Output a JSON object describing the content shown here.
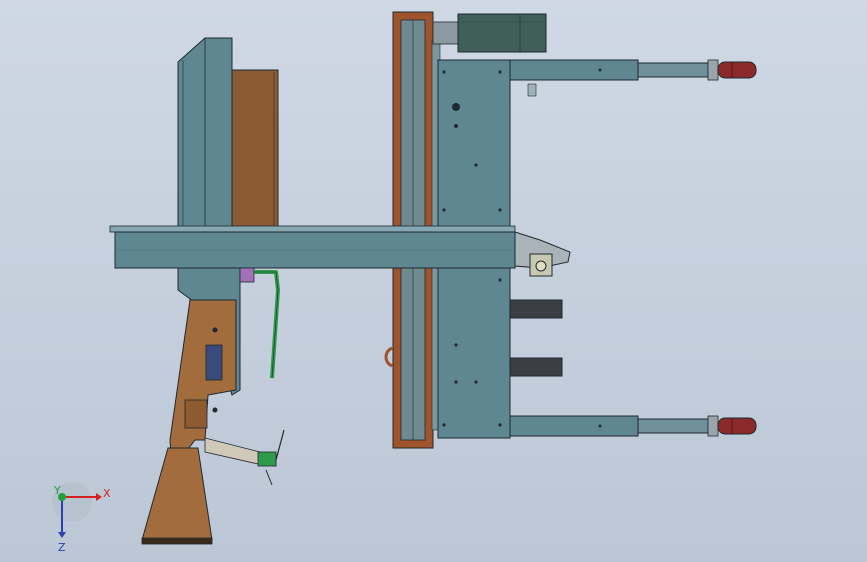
{
  "triad": {
    "x_label": "X",
    "y_label": "Y",
    "z_label": "Z",
    "x_color": "#d42020",
    "y_color": "#20a040",
    "z_color": "#2a3fb0"
  },
  "colors": {
    "background_top": "#cfd8e4",
    "background_bottom": "#bcc7d6",
    "steel_blue": "#5f8792",
    "steel_blue_light": "#86a8b2",
    "wood_brown": "#a26c3c",
    "wood_dark": "#7b4f2a",
    "outline": "#1e2a30",
    "dark_block": "#3b3f44",
    "wheel_red": "#8a2a2a",
    "handle_green": "#2f9a4a",
    "motor_dark": "#3f5f58"
  },
  "icons": {
    "axis_triad": "coordinate-axis-triad-icon"
  }
}
